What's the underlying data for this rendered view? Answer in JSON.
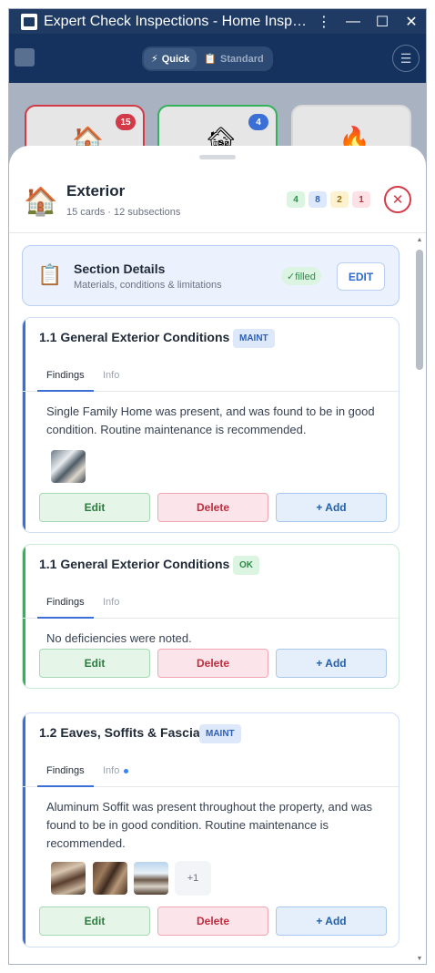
{
  "window": {
    "title": "Expert Check Inspections - Home Insp…",
    "controls": [
      "more-vert-icon",
      "minimize-icon",
      "maximize-icon",
      "close-icon"
    ]
  },
  "appbar": {
    "modes": [
      {
        "label": "Quick",
        "icon": "⚡",
        "active": true
      },
      {
        "label": "Standard",
        "icon": "📋",
        "active": false
      }
    ],
    "menu_icon": "☰"
  },
  "background_cards": [
    {
      "badge": "15",
      "badge_color": "#d33a47",
      "icon": "🏠"
    },
    {
      "badge": "4",
      "badge_color": "#3b6fd6",
      "icon": "🏚"
    },
    {
      "badge": "",
      "badge_color": "",
      "icon": "🔥"
    }
  ],
  "section": {
    "icon": "🏠",
    "title": "Exterior",
    "subtitle": "15 cards · 12 subsections",
    "counts": [
      {
        "value": "4",
        "bg": "#dcf5e3",
        "color": "#2f8a49"
      },
      {
        "value": "8",
        "bg": "#dde8fb",
        "color": "#2f5fb5"
      },
      {
        "value": "2",
        "bg": "#fdf2cf",
        "color": "#9a6b0c"
      },
      {
        "value": "1",
        "bg": "#fde2e5",
        "color": "#c12d3f"
      }
    ],
    "close_icon": "✕"
  },
  "details": {
    "icon": "📋",
    "title": "Section Details",
    "subtitle": "Materials, conditions & limitations",
    "status": "✓filled",
    "edit_label": "EDIT"
  },
  "cards": [
    {
      "title": "1.1 General Exterior Conditions",
      "tag": "MAINT",
      "accent": "#3b6fd6",
      "tabs": [
        "Findings",
        "Info"
      ],
      "info_dot": false,
      "finding": "Single Family Home was present, and was found to be in good condition. Routine maintenance is recommended.",
      "photos": 1,
      "more": "",
      "buttons": {
        "edit": "Edit",
        "delete": "Delete",
        "add": "+ Add"
      }
    },
    {
      "title": "1.1 General Exterior Conditions",
      "tag": "OK",
      "accent": "#34b25a",
      "tabs": [
        "Findings",
        "Info"
      ],
      "info_dot": false,
      "finding": "No deficiencies were noted.",
      "photos": 0,
      "more": "",
      "buttons": {
        "edit": "Edit",
        "delete": "Delete",
        "add": "+ Add"
      }
    },
    {
      "title": "1.2 Eaves, Soffits & Fascia",
      "tag": "MAINT",
      "accent": "#3b6fd6",
      "tabs": [
        "Findings",
        "Info"
      ],
      "info_dot": true,
      "finding": "Aluminum Soffit was present throughout the property, and was found to be in good condition. Routine maintenance is recommended.",
      "photos": 3,
      "more": "+1",
      "buttons": {
        "edit": "Edit",
        "delete": "Delete",
        "add": "+ Add"
      }
    }
  ]
}
